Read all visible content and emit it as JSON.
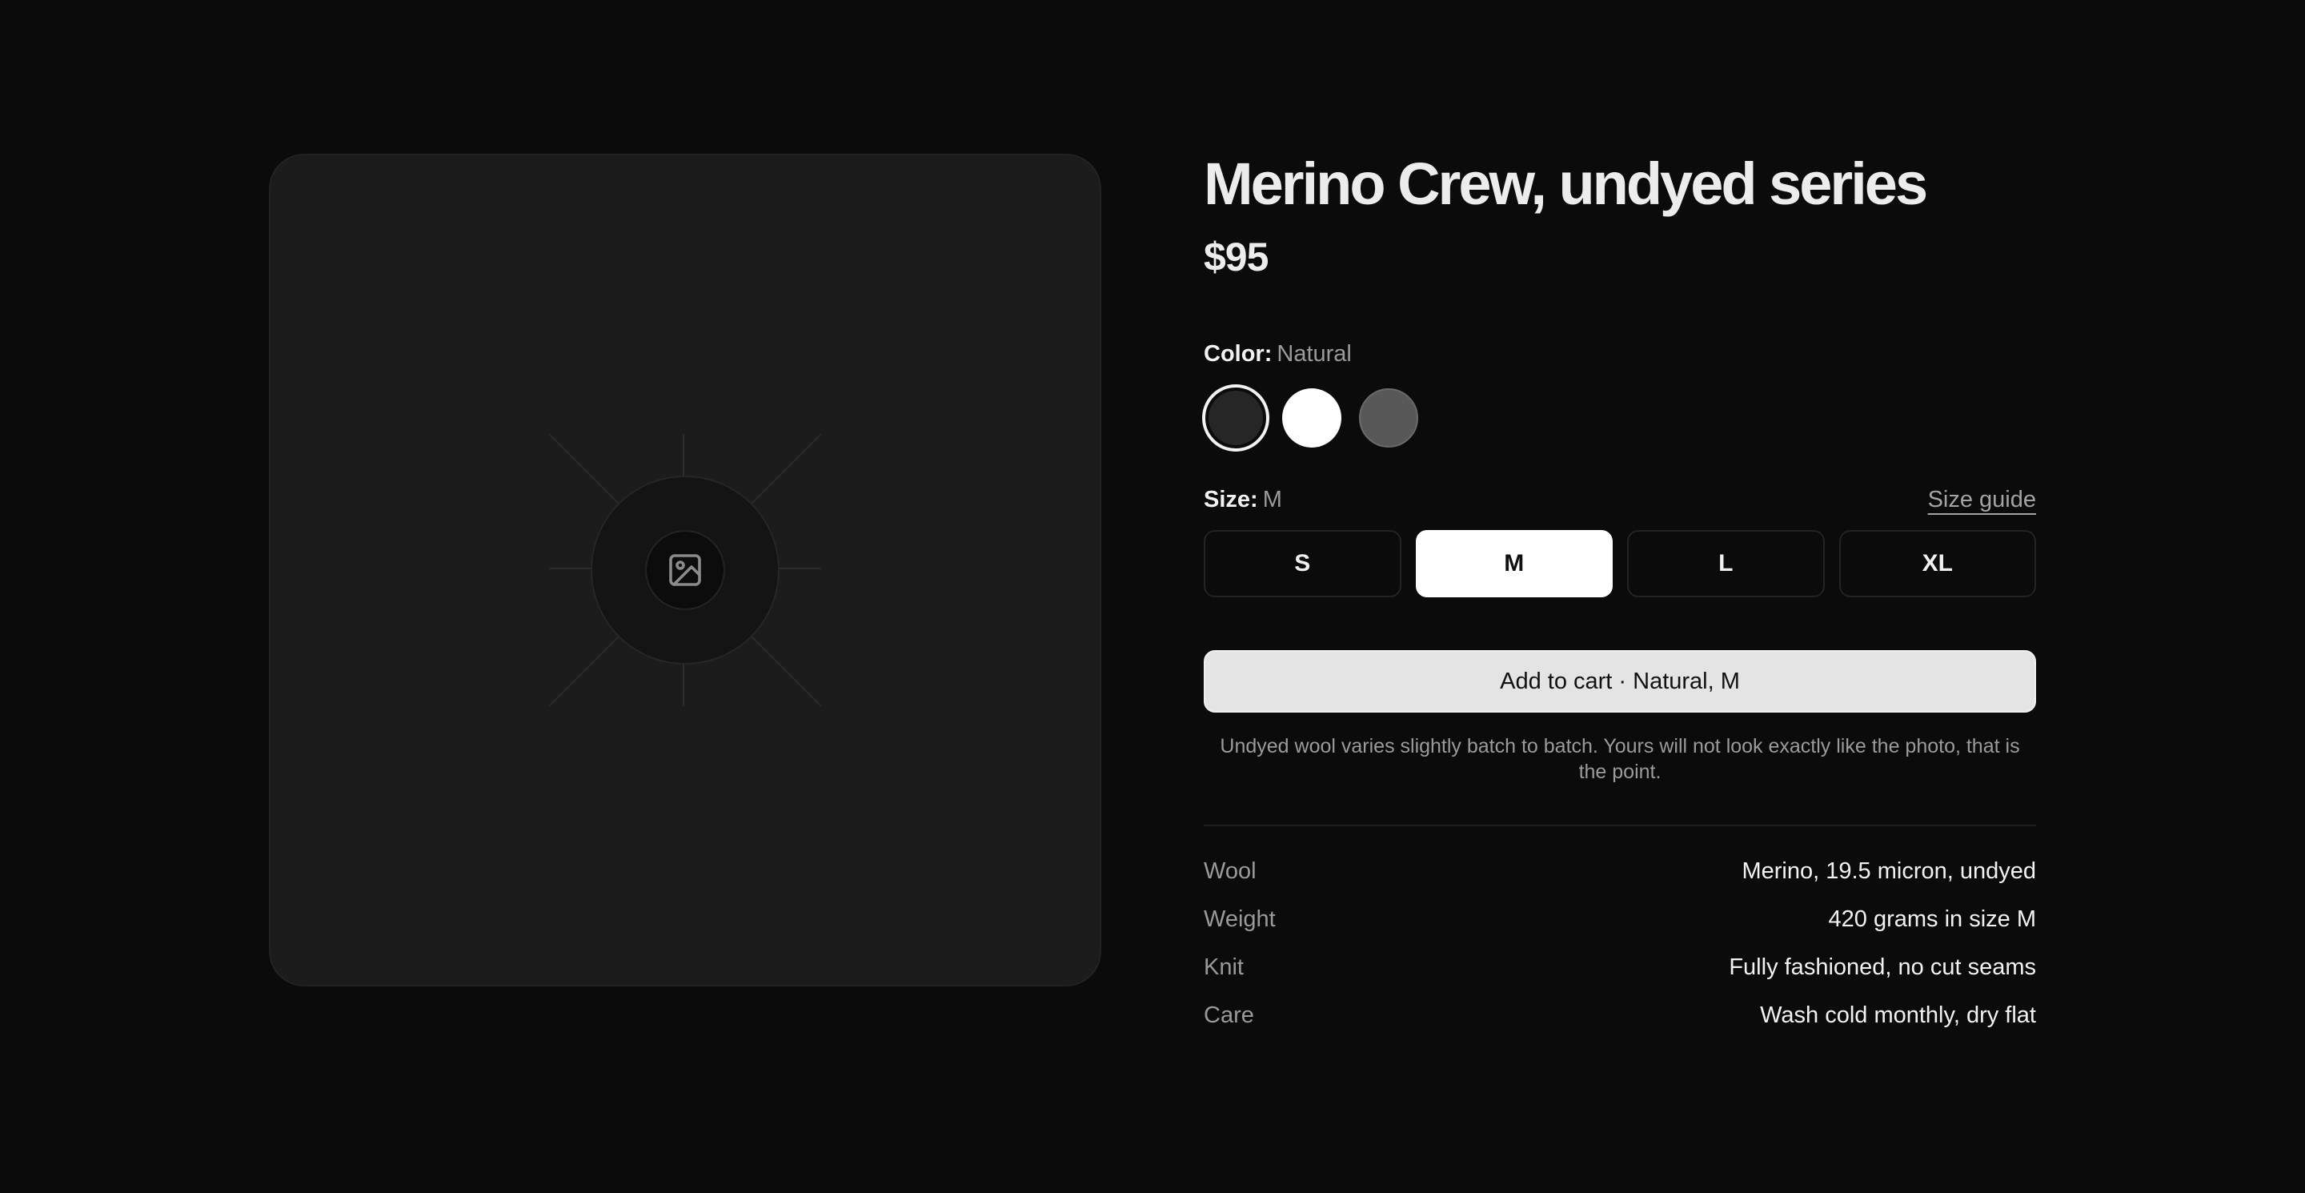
{
  "product": {
    "title": "Merino Crew, undyed series",
    "price": "$95"
  },
  "color": {
    "label": "Color:",
    "selected": "Natural",
    "swatches": [
      {
        "name": "charcoal",
        "hex": "#262626",
        "selected": true
      },
      {
        "name": "white",
        "hex": "#ffffff",
        "selected": false
      },
      {
        "name": "grey",
        "hex": "#585858",
        "selected": false
      }
    ]
  },
  "size": {
    "label": "Size:",
    "selected": "M",
    "guide_label": "Size guide",
    "options": [
      "S",
      "M",
      "L",
      "XL"
    ]
  },
  "cart": {
    "label": "Add to cart · Natural, M"
  },
  "note": "Undyed wool varies slightly batch to batch. Yours will not look exactly like the photo, that is the point.",
  "specs": [
    {
      "key": "Wool",
      "value": "Merino, 19.5 micron, undyed"
    },
    {
      "key": "Weight",
      "value": "420 grams in size M"
    },
    {
      "key": "Knit",
      "value": "Fully fashioned, no cut seams"
    },
    {
      "key": "Care",
      "value": "Wash cold monthly, dry flat"
    }
  ],
  "icons": {
    "image_placeholder": "image-icon"
  }
}
